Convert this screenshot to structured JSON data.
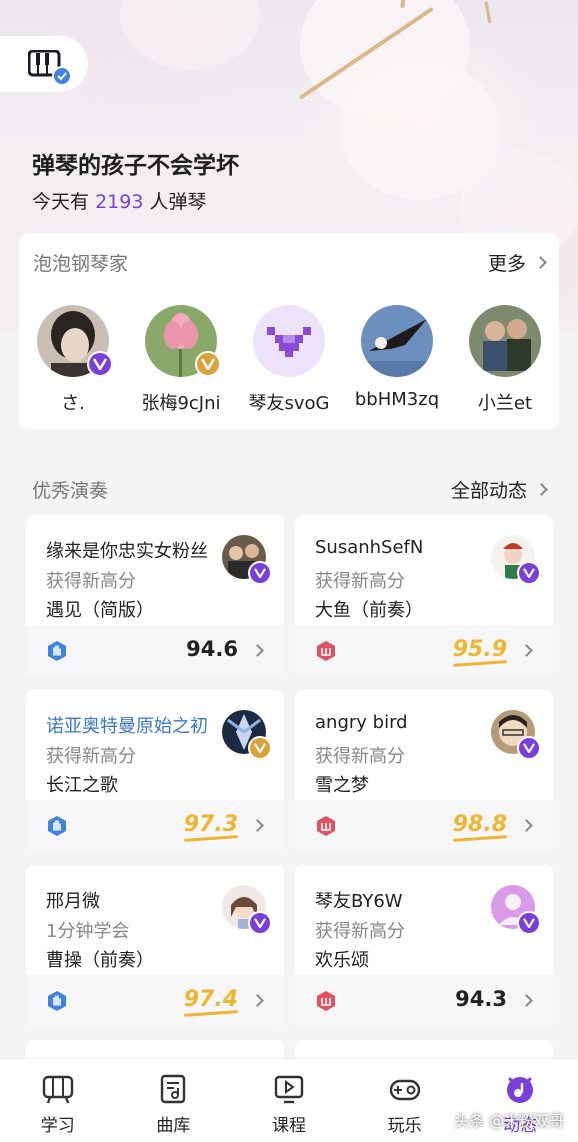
{
  "hero": {
    "title": "弹琴的孩子不会学坏",
    "sub_prefix": "今天有",
    "count": "2193",
    "sub_suffix": "人弹琴"
  },
  "family": {
    "title": "泡泡钢琴家",
    "more": "更多",
    "members": [
      {
        "name": "さ.",
        "badge": "purple"
      },
      {
        "name": "张梅9cJni",
        "badge": "gold"
      },
      {
        "name": "琴友svoG",
        "badge": "none"
      },
      {
        "name": "bbHM3zq",
        "badge": "none"
      },
      {
        "name": "小兰et",
        "badge": "none"
      }
    ]
  },
  "performances": {
    "title": "优秀演奏",
    "more": "全部动态",
    "cards": [
      {
        "user": "缘来是你忠实女粉丝",
        "subtitle": "获得新高分",
        "song": "遇见（简版）",
        "score": "94.6",
        "hand": "blue",
        "highlight": false
      },
      {
        "user": "SusanhSefN",
        "subtitle": "获得新高分",
        "song": "大鱼（前奏）",
        "score": "95.9",
        "hand": "red",
        "highlight": true
      },
      {
        "user": "诺亚奥特曼原始之初",
        "subtitle": "获得新高分",
        "song": "长江之歌",
        "score": "97.3",
        "hand": "blue",
        "highlight": true
      },
      {
        "user": "angry bird",
        "subtitle": "获得新高分",
        "song": "雪之梦",
        "score": "98.8",
        "hand": "red",
        "highlight": true
      },
      {
        "user": "邢月微",
        "subtitle": "1分钟学会",
        "song": "曹操（前奏）",
        "score": "97.4",
        "hand": "blue",
        "highlight": true
      },
      {
        "user": "琴友BY6W",
        "subtitle": "获得新高分",
        "song": "欢乐颂",
        "score": "94.3",
        "hand": "red",
        "highlight": false
      }
    ]
  },
  "nav": {
    "items": [
      {
        "label": "学习",
        "icon": "piano-icon"
      },
      {
        "label": "曲库",
        "icon": "music-library-icon"
      },
      {
        "label": "课程",
        "icon": "course-play-icon"
      },
      {
        "label": "玩乐",
        "icon": "gamepad-icon"
      },
      {
        "label": "动态",
        "icon": "feed-note-icon",
        "active": true
      }
    ]
  },
  "watermark": "头条 @米粉双哥",
  "colors": {
    "accent": "#7b3fd9",
    "gold": "#f0b52e",
    "blue_user": "#3a78c3",
    "hand_blue": "#3f83e0",
    "hand_red": "#e05262"
  }
}
